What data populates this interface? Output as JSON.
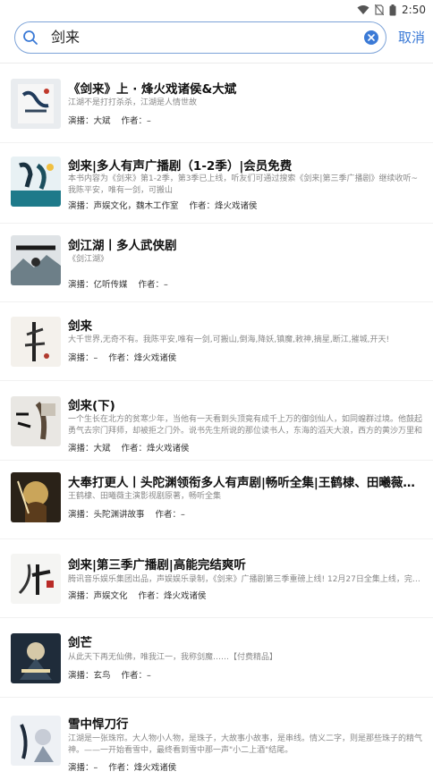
{
  "status": {
    "time": "2:50"
  },
  "search": {
    "query": "剑来",
    "cancel_label": "取消"
  },
  "labels": {
    "cast": "演播：",
    "author": "作者："
  },
  "results": [
    {
      "title": "《剑来》上 · 烽火戏诸侯&大斌",
      "desc": "江湖不是打打杀杀，江湖是人情世故",
      "cast": "大斌",
      "author": "–"
    },
    {
      "title": "剑来|多人有声广播剧（1-2季）|会员免费",
      "desc": "本书内容为《剑来》第1-2季，第3季已上线，听友们可通过搜索《剑来|第三季广播剧》继续收听~ 我陈平安，唯有一剑，可搬山",
      "cast": "声娱文化，魏木工作室",
      "author": "烽火戏诸侯"
    },
    {
      "title": "剑江湖丨多人武侠剧",
      "desc": "《剑江湖》",
      "cast": "亿听传媒",
      "author": "–"
    },
    {
      "title": "剑来",
      "desc": "大千世界,无奇不有。我陈平安,唯有一剑,可搬山,倒海,降妖,镇魔,敕神,摘星,断江,摧城,开天!",
      "cast": "–",
      "author": "烽火戏诸侯"
    },
    {
      "title": "剑来(下)",
      "desc": "一个生长在北方的贫寒少年，当他有一天看到头顶竟有成千上万的御剑仙人，如同蝗群过境。他鼓起勇气去宗门拜师，却被拒之门外。说书先生所说的那位读书人，东海的滔天大浪，西方的黄沙万里和南荒的巍峨大山。 于…",
      "cast": "大斌",
      "author": "烽火戏诸侯"
    },
    {
      "title": "大奉打更人丨头陀渊领衔多人有声剧|畅听全集|王鹤棣、田曦薇主演…",
      "desc": "王鹤棣、田曦薇主演影视剧原著，畅听全集",
      "cast": "头陀渊讲故事",
      "author": "–"
    },
    {
      "title": "剑来|第三季广播剧|高能完结爽听",
      "desc": "腾讯音乐娱乐集团出品，声娱娱乐录制，《剑来》广播剧第三季重磅上线! 12月27日全集上线，完结爽听",
      "cast": "声娱文化",
      "author": "烽火戏诸侯"
    },
    {
      "title": "剑芒",
      "desc": "从此天下再无仙佛，唯我江一，我称剑魔……【付费精品】",
      "cast": "玄鸟",
      "author": "–"
    },
    {
      "title": "雪中悍刀行",
      "desc": "江湖是一张珠帘。大人物小人物，是珠子，大故事小故事，是串线。情义二字，则是那些珠子的精气神。——一开始看雪中，最终看到雪中那一声\"小二上酒\"结尾。",
      "cast": "–",
      "author": "烽火戏诸侯"
    }
  ]
}
